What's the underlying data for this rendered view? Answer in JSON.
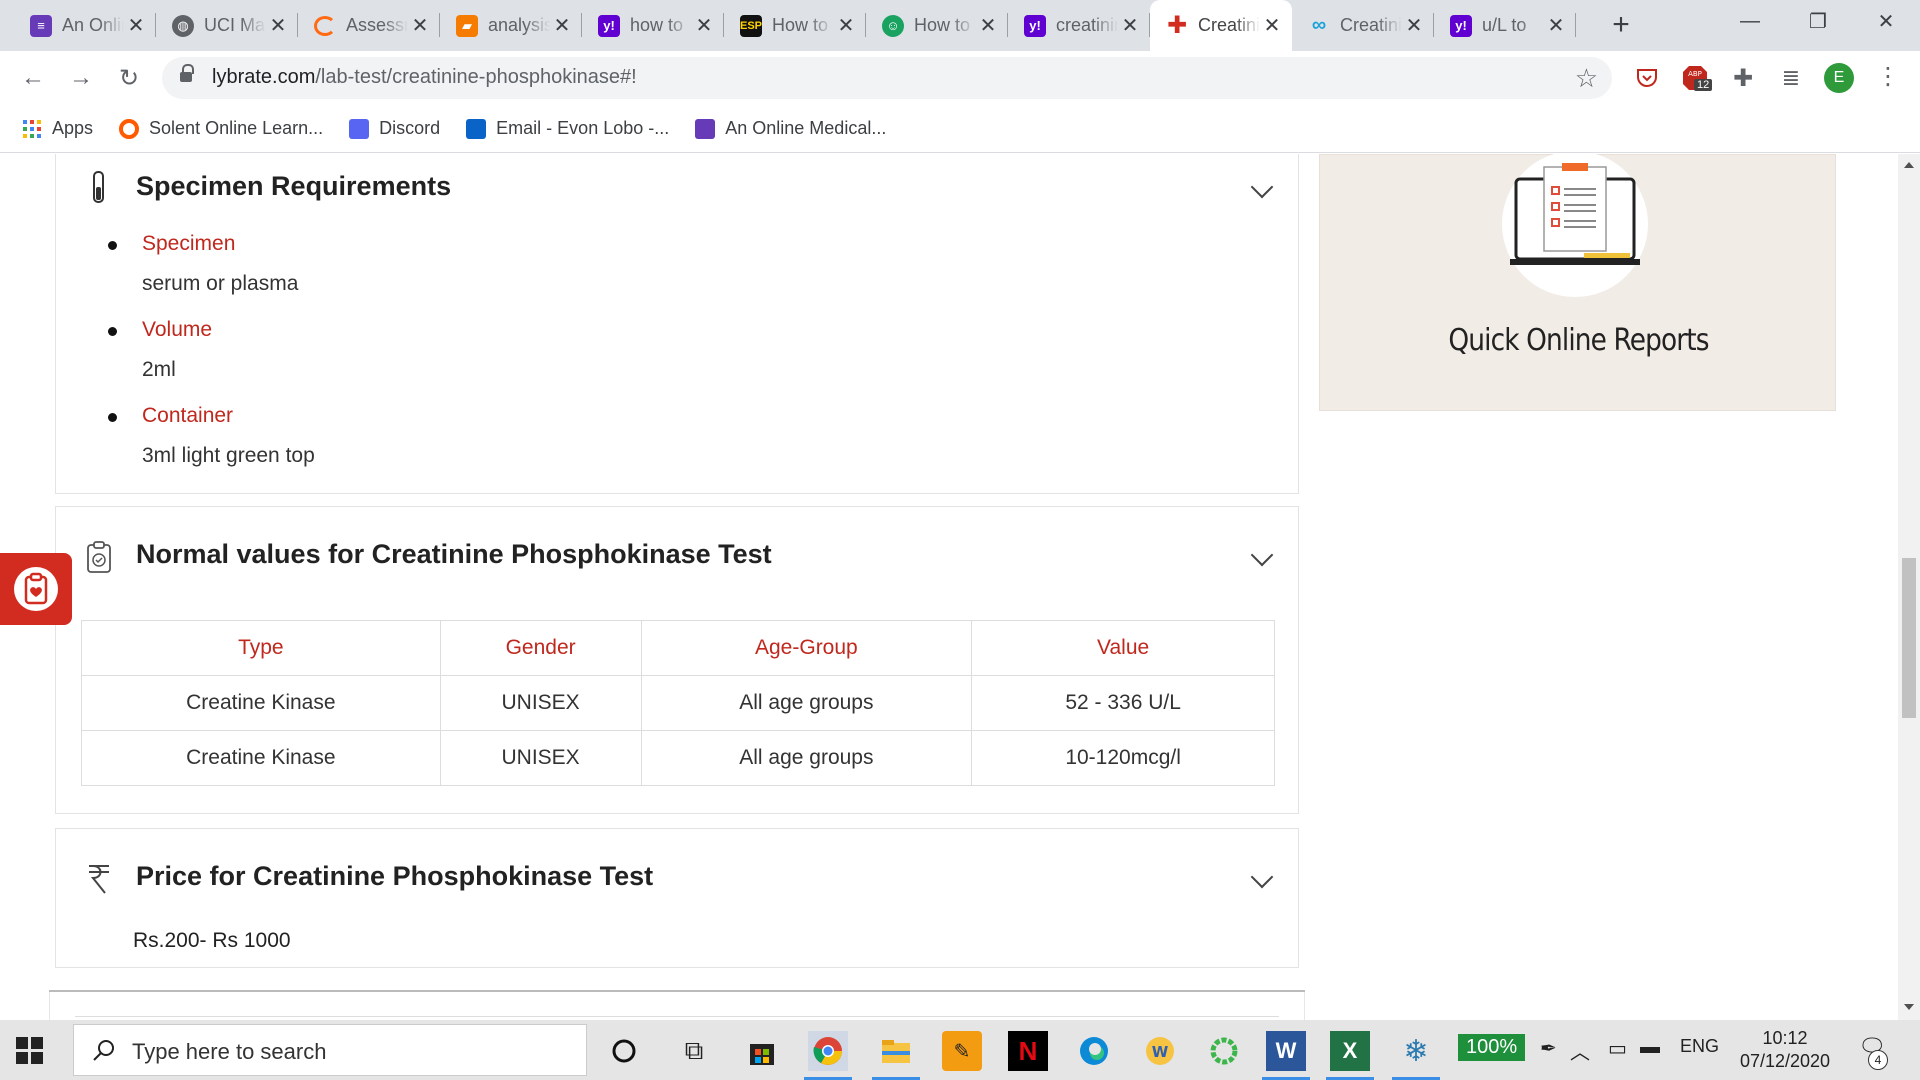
{
  "browser": {
    "tabs": [
      {
        "title": "An Online Medical...",
        "favicon": "forms-icon",
        "color": "#673ab7",
        "active": false
      },
      {
        "title": "UCI Machine Learning",
        "favicon": "globe-icon",
        "color": "#5f6368",
        "active": false
      },
      {
        "title": "Assessment",
        "favicon": "ring-icon",
        "color": "#ff6a13",
        "active": false
      },
      {
        "title": "analysis",
        "favicon": "book-icon",
        "color": "#f57c00",
        "active": false
      },
      {
        "title": "how to",
        "favicon": "yahoo-icon",
        "color": "#6001d2",
        "active": false
      },
      {
        "title": "How to",
        "favicon": "esp-icon",
        "color": "#111111",
        "active": false
      },
      {
        "title": "How to",
        "favicon": "robot-icon",
        "color": "#1aa260",
        "active": false
      },
      {
        "title": "creatinine",
        "favicon": "yahoo-icon",
        "color": "#6001d2",
        "active": false
      },
      {
        "title": "Creatinine",
        "favicon": "lybrate-icon",
        "color": "#d12c1f",
        "active": true
      },
      {
        "title": "Creatinine",
        "favicon": "link-icon",
        "color": "#1aa3d9",
        "active": false
      },
      {
        "title": "u/L to",
        "favicon": "yahoo-icon",
        "color": "#6001d2",
        "active": false
      }
    ],
    "url_host": "lybrate.com",
    "url_path": "/lab-test/creatinine-phosphokinase#!",
    "profile_initial": "E",
    "abp_badge": "12",
    "bookmarks": [
      {
        "label": "Apps",
        "icon": "apps-grid-icon",
        "color": "#4285f4"
      },
      {
        "label": "Solent Online Learn...",
        "icon": "solent-icon",
        "color": "#ff5a00"
      },
      {
        "label": "Discord",
        "icon": "discord-icon",
        "color": "#5865f2"
      },
      {
        "label": "Email - Evon Lobo -...",
        "icon": "outlook-icon",
        "color": "#0a64c8"
      },
      {
        "label": "An Online Medical...",
        "icon": "forms-icon",
        "color": "#673ab7"
      }
    ]
  },
  "page": {
    "specimen": {
      "heading": "Specimen Requirements",
      "items": [
        {
          "label": "Specimen",
          "value": "serum or plasma"
        },
        {
          "label": "Volume",
          "value": "2ml"
        },
        {
          "label": "Container",
          "value": "3ml light green top"
        }
      ]
    },
    "normal_values": {
      "heading": "Normal values for Creatinine Phosphokinase Test",
      "columns": [
        "Type",
        "Gender",
        "Age-Group",
        "Value"
      ],
      "rows": [
        [
          "Creatine Kinase",
          "UNISEX",
          "All age groups",
          "52 - 336 U/L"
        ],
        [
          "Creatine Kinase",
          "UNISEX",
          "All age groups",
          "10-120mcg/l"
        ]
      ]
    },
    "price": {
      "heading": "Price for Creatinine Phosphokinase Test",
      "value": "Rs.200- Rs 1000"
    },
    "side_banner": {
      "caption": "Quick Online Reports"
    },
    "accent_color": "#c0281e"
  },
  "taskbar": {
    "search_placeholder": "Type here to search",
    "battery": "100%",
    "language": "ENG",
    "time": "10:12",
    "date": "07/12/2020",
    "notification_count": "4"
  }
}
